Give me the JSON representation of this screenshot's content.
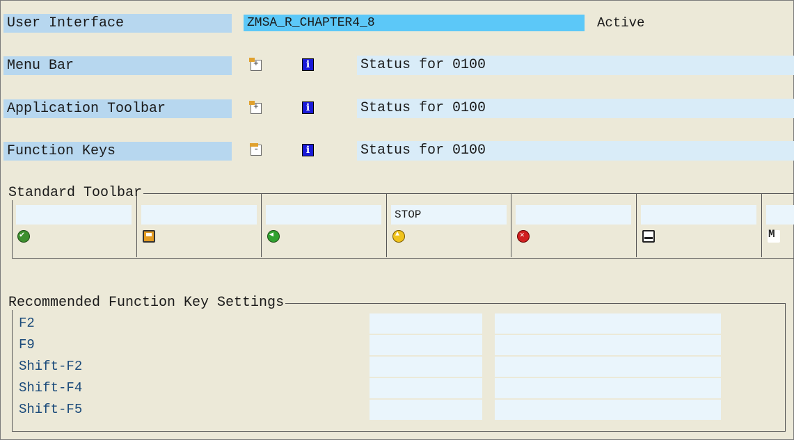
{
  "header": {
    "label": "User Interface",
    "program": "ZMSA_R_CHAPTER4_8",
    "status": "Active"
  },
  "rows": [
    {
      "label": "Menu Bar",
      "icon": "expand-icon",
      "value": "Status for 0100"
    },
    {
      "label": "Application Toolbar",
      "icon": "expand-icon",
      "value": "Status for 0100"
    },
    {
      "label": "Function Keys",
      "icon": "collapse-icon",
      "value": "Status for 0100"
    }
  ],
  "standard_toolbar": {
    "title": "Standard Toolbar",
    "buttons": [
      {
        "text": "",
        "icon": "ok-icon"
      },
      {
        "text": "",
        "icon": "save-icon"
      },
      {
        "text": "",
        "icon": "back-icon"
      },
      {
        "text": "STOP",
        "icon": "exit-icon"
      },
      {
        "text": "",
        "icon": "cancel-icon"
      },
      {
        "text": "",
        "icon": "print-icon"
      },
      {
        "text": "",
        "icon": "find-icon"
      }
    ]
  },
  "function_keys": {
    "title": "Recommended Function Key Settings",
    "keys": [
      "F2",
      "F9",
      "Shift-F2",
      "Shift-F4",
      "Shift-F5"
    ]
  },
  "colors": {
    "background": "#ece9d8",
    "label_bg": "#b7d7ef",
    "active_field": "#5cc8f8",
    "field_bg": "#d9ecf8"
  }
}
